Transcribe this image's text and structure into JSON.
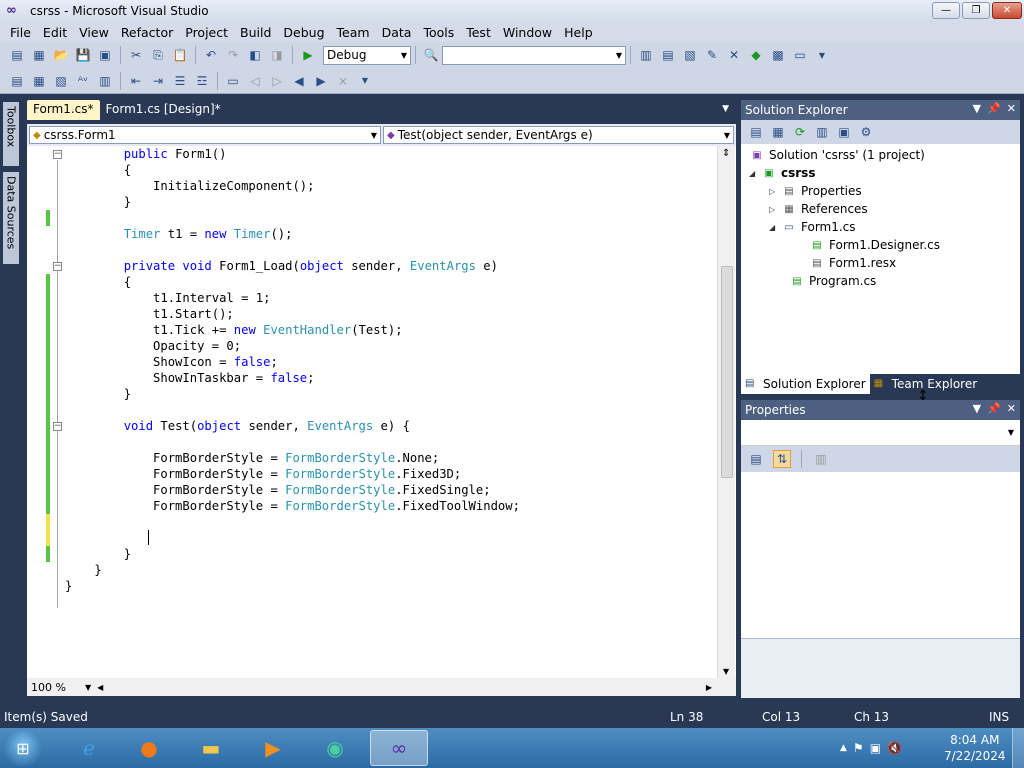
{
  "window": {
    "title": "csrss - Microsoft Visual Studio",
    "minimize_icon": "minimize-icon",
    "maximize_icon": "restore-icon",
    "close_icon": "close-icon"
  },
  "menu": [
    "File",
    "Edit",
    "View",
    "Refactor",
    "Project",
    "Build",
    "Debug",
    "Team",
    "Data",
    "Tools",
    "Test",
    "Window",
    "Help"
  ],
  "toolbar": {
    "config_value": "Debug",
    "search_value": ""
  },
  "side_tabs": [
    "Toolbox",
    "Data Sources"
  ],
  "doc_tabs": [
    {
      "label": "Form1.cs*",
      "active": true
    },
    {
      "label": "Form1.cs [Design]*",
      "active": false
    }
  ],
  "navbar": {
    "class_combo": "csrss.Form1",
    "member_combo": "Test(object sender, EventArgs e)"
  },
  "code_lines": [
    "        public Form1()",
    "        {",
    "            InitializeComponent();",
    "        }",
    "",
    "        Timer t1 = new Timer();",
    "",
    "        private void Form1_Load(object sender, EventArgs e)",
    "        {",
    "            t1.Interval = 1;",
    "            t1.Start();",
    "            t1.Tick += new EventHandler(Test);",
    "            Opacity = 0;",
    "            ShowIcon = false;",
    "            ShowInTaskbar = false;",
    "        }",
    "",
    "        void Test(object sender, EventArgs e) {",
    "",
    "            FormBorderStyle = FormBorderStyle.None;",
    "            FormBorderStyle = FormBorderStyle.Fixed3D;",
    "            FormBorderStyle = FormBorderStyle.FixedSingle;",
    "            FormBorderStyle = FormBorderStyle.FixedToolWindow;",
    "",
    "",
    "        }",
    "    }",
    "}"
  ],
  "editor_footer": {
    "zoom": "100 %"
  },
  "solution_explorer": {
    "title": "Solution Explorer",
    "items": [
      {
        "label": "Solution 'csrss' (1 project)",
        "icon": "solution-icon"
      },
      {
        "label": "csrss",
        "icon": "csharp-project-icon"
      },
      {
        "label": "Properties",
        "icon": "properties-folder-icon"
      },
      {
        "label": "References",
        "icon": "references-icon"
      },
      {
        "label": "Form1.cs",
        "icon": "form-icon"
      },
      {
        "label": "Form1.Designer.cs",
        "icon": "cs-file-icon"
      },
      {
        "label": "Form1.resx",
        "icon": "resx-file-icon"
      },
      {
        "label": "Program.cs",
        "icon": "cs-file-icon"
      }
    ],
    "bottom_tabs": [
      "Solution Explorer",
      "Team Explorer"
    ]
  },
  "properties": {
    "title": "Properties",
    "object_combo": ""
  },
  "status": {
    "message": "Item(s) Saved",
    "line": "Ln 38",
    "col": "Col 13",
    "ch": "Ch 13",
    "mode": "INS"
  },
  "taskbar": {
    "time": "8:04 AM",
    "date": "7/22/2024"
  },
  "colors": {
    "keyword": "#0000ff",
    "type": "#2b91af",
    "chrome_dark": "#293955",
    "change_saved": "#57c544",
    "change_unsaved": "#f4e04d"
  }
}
